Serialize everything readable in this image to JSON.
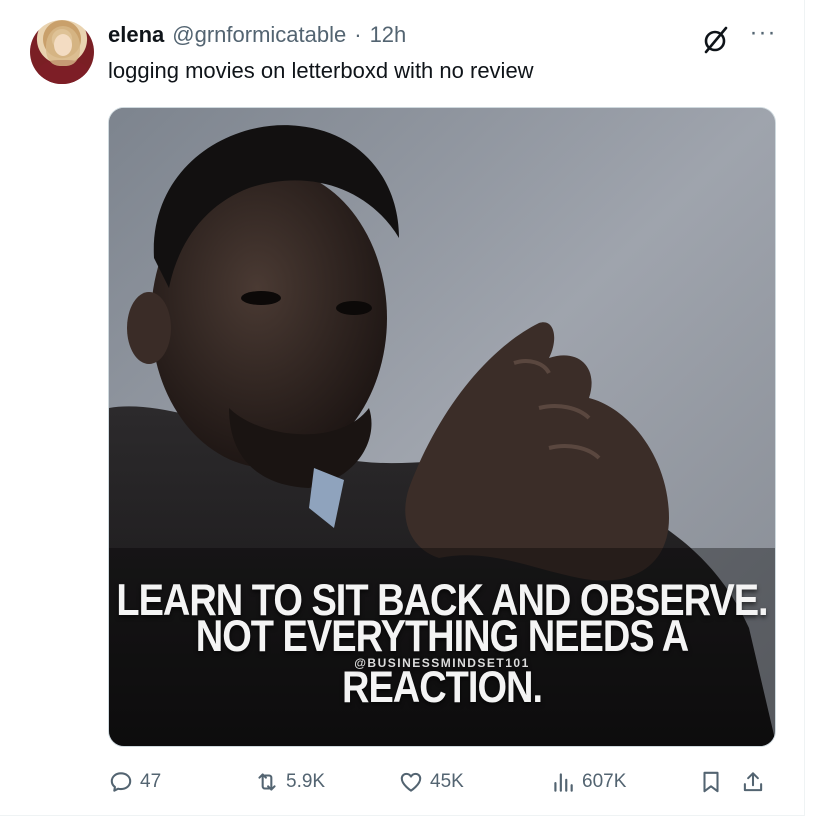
{
  "post": {
    "display_name": "elena",
    "handle": "@grnformicatable",
    "separator": "·",
    "time": "12h",
    "text": "logging movies on letterboxd with no review"
  },
  "media": {
    "caption_line1": "LEARN TO SIT BACK AND OBSERVE.",
    "caption_line2": "NOT EVERYTHING NEEDS A REACTION.",
    "credit": "@BUSINESSMINDSET101"
  },
  "actions": {
    "replies": "47",
    "reposts": "5.9K",
    "likes": "45K",
    "views": "607K"
  },
  "icons": {
    "grok": "grok-icon",
    "more": "more-icon",
    "reply": "reply-icon",
    "repost": "repost-icon",
    "like": "like-icon",
    "views": "views-icon",
    "bookmark": "bookmark-icon",
    "share": "share-icon"
  },
  "colors": {
    "text": "#0f1419",
    "secondary": "#536471",
    "border": "#cfd9de"
  }
}
